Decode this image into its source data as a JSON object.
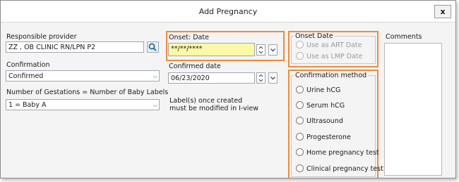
{
  "window": {
    "title": "Add Pregnancy",
    "close_label": "x"
  },
  "left": {
    "responsible_provider_label": "Responsible provider",
    "responsible_provider_value": "ZZ , OB CLINIC RN/LPN P2",
    "confirmation_label": "Confirmation",
    "confirmation_value": "Confirmed",
    "gestations_label": "Number of Gestations = Number of Baby Labels",
    "gestations_value": "1 = Baby A"
  },
  "middle": {
    "onset_label": "Onset: Date",
    "onset_value": "**/**/****",
    "confirmed_date_label": "Confirmed date",
    "confirmed_date_value": "06/23/2020",
    "note_line1": "Label(s) once created",
    "note_line2": "must be modified in I-view"
  },
  "onset_group": {
    "title": "Onset Date",
    "options": [
      "Use as ART Date",
      "Use as LMP Date"
    ]
  },
  "confirmation_method": {
    "title": "Confirmation method",
    "options": [
      "Urine hCG",
      "Serum hCG",
      "Ultrasound",
      "Progesterone",
      "Home pregnancy test",
      "Clinical pregnancy test"
    ]
  },
  "comments": {
    "label": "Comments"
  },
  "colors": {
    "highlight": "#ee8a3a",
    "onset_field_bg": "#fbf8a8"
  }
}
